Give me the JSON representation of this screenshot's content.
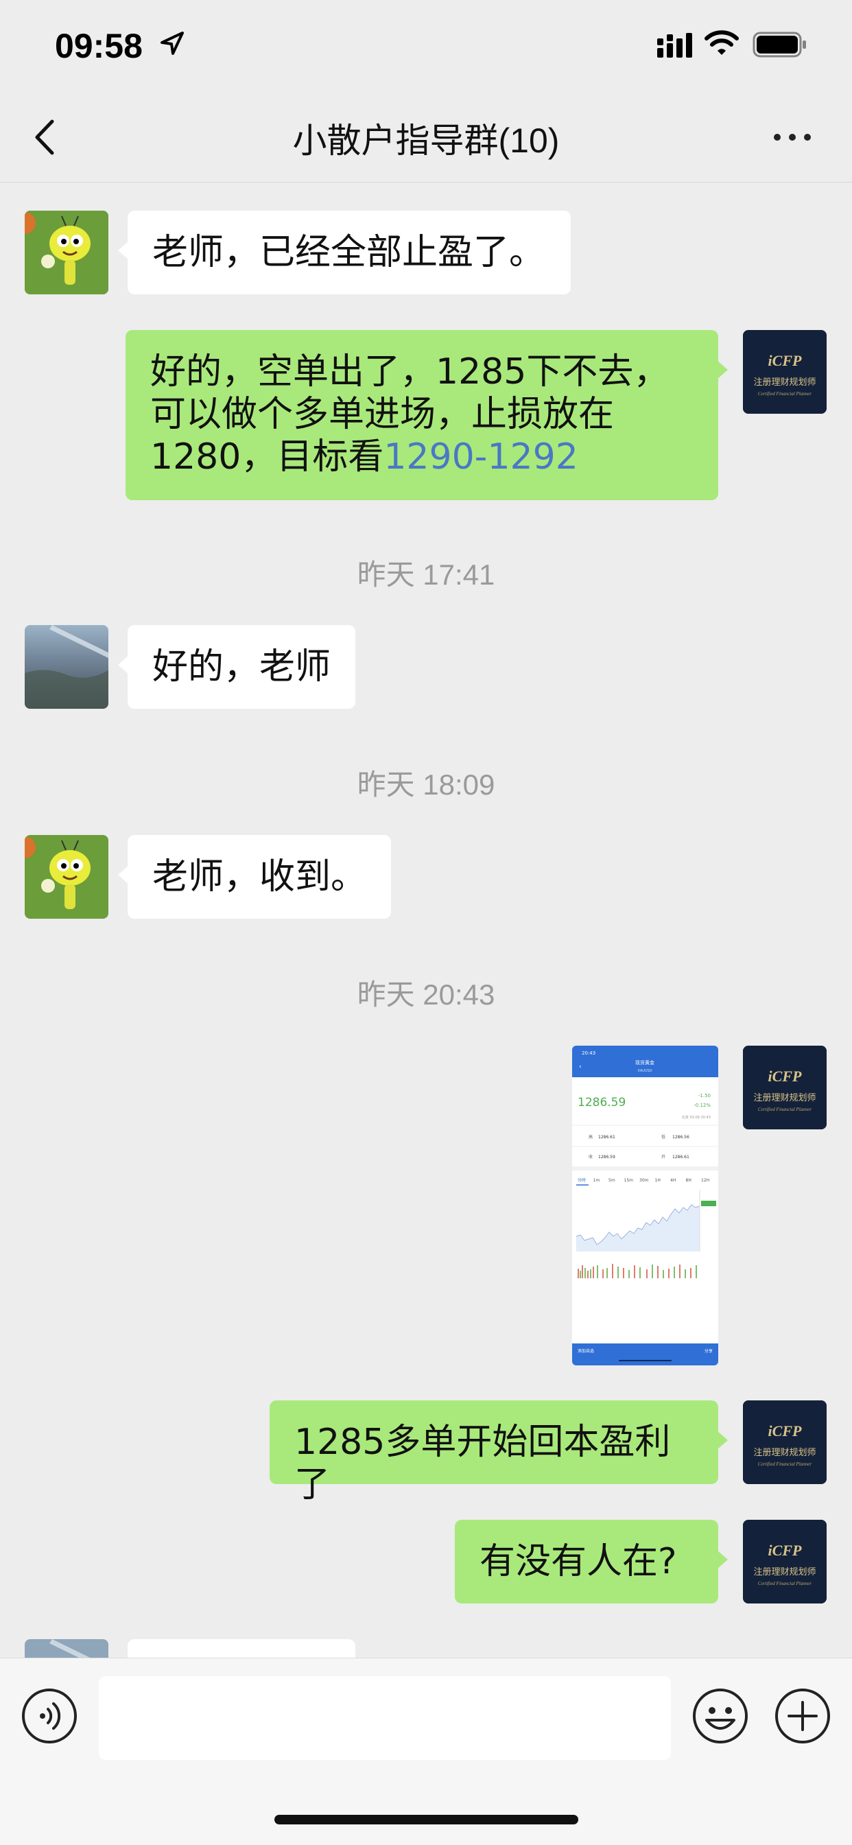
{
  "status": {
    "time": "09:58"
  },
  "header": {
    "title": "小散户指导群(10)"
  },
  "messages": {
    "m1": "老师，已经全部止盈了。",
    "m2_text": "好的，空单出了，1285下不去，可以做个多单进场，止损放在1280，目标看",
    "m2_link": "1290-1292",
    "t1": "昨天 17:41",
    "m3": "好的，老师",
    "t2": "昨天 18:09",
    "m4": "老师，收到。",
    "t3": "昨天 20:43",
    "m5": "1285多单开始回本盈利了",
    "m6": "有没有人在?"
  },
  "badge": {
    "logo": "iCFP",
    "line1": "注册理财规划师",
    "line2": "Certified Financial Planner"
  },
  "shot": {
    "time": "20:43",
    "title": "现货黄金",
    "symbol": "XAUUSD",
    "price": "1286.59",
    "change": "-1.50",
    "pct": "-0.12%",
    "date": "北京 03-09 20:43",
    "high_label": "高",
    "high": "1286.61",
    "low_label": "低",
    "low": "1286.56",
    "prev_label": "收",
    "prev": "1286.59",
    "open_label": "开",
    "open": "1286.61",
    "tabs": [
      "分时",
      "1m",
      "5m",
      "15m",
      "30m",
      "1H",
      "4H",
      "8H",
      "12H"
    ],
    "footer_left": "添加自选",
    "footer_right": "分享"
  },
  "colors": {
    "bubble_green": "#a9e97b",
    "bubble_white": "#ffffff",
    "link": "#4a78c4",
    "background": "#ededed"
  }
}
